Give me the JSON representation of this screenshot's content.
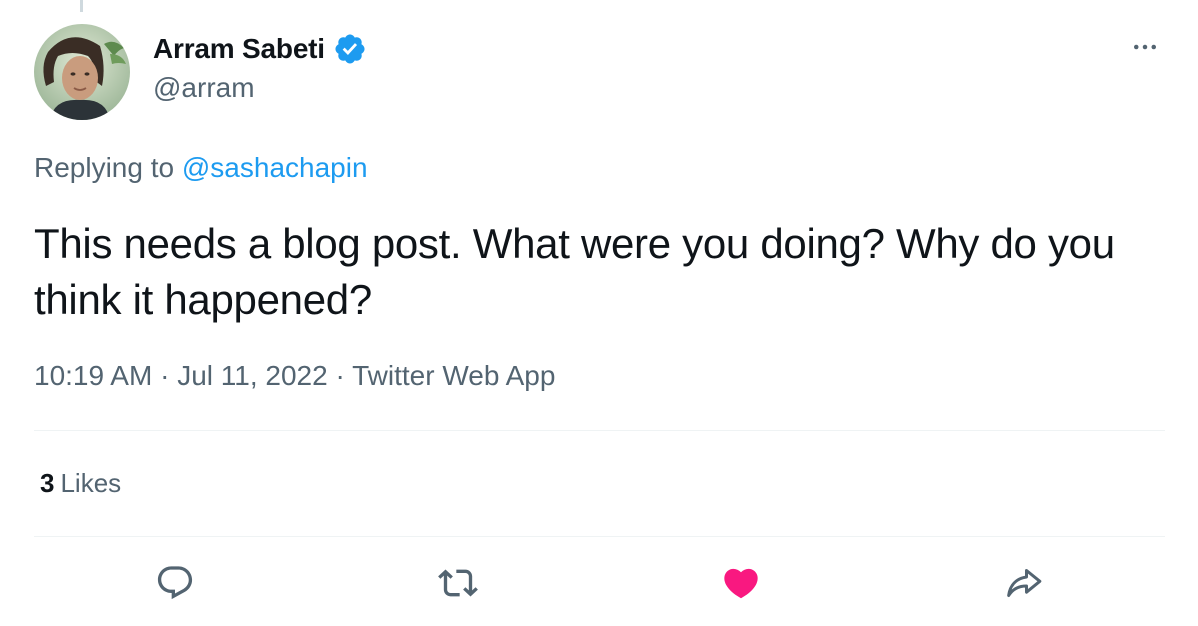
{
  "author": {
    "display_name": "Arram Sabeti",
    "handle": "@arram",
    "verified": true,
    "avatar": "avatar-photo"
  },
  "reply": {
    "prefix": "Replying to",
    "mention": "@sashachapin"
  },
  "tweet": {
    "text": "This needs a blog post. What were you doing? Why do you think it happened?"
  },
  "meta": {
    "time": "10:19 AM",
    "separator": "·",
    "date": "Jul 11, 2022",
    "source": "Twitter Web App"
  },
  "stats": {
    "likes_count": "3",
    "likes_label": "Likes"
  },
  "icons": {
    "more": "more-dots-icon",
    "reply": "reply-icon",
    "retweet": "retweet-icon",
    "like": "heart-icon",
    "share": "share-icon",
    "verified": "verified-badge-icon"
  },
  "colors": {
    "accent": "#1d9bf0",
    "like": "#f91880",
    "secondary_text": "#536471",
    "primary_text": "#0f1419"
  },
  "state": {
    "liked": true
  }
}
